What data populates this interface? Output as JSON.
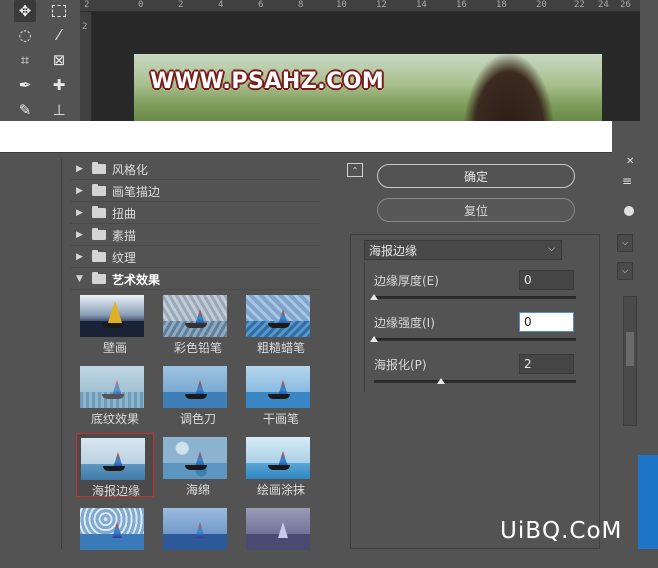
{
  "photoshop": {
    "ruler_top": [
      "2",
      "0",
      "2",
      "4",
      "6",
      "8",
      "10",
      "12",
      "14",
      "16",
      "18",
      "20",
      "22",
      "24",
      "26"
    ],
    "ruler_left": [
      "2"
    ],
    "photo_watermark": "WWW.PSAHZ.COM",
    "tools": [
      "move-icon",
      "marquee-icon",
      "lasso-icon",
      "magic-wand-icon",
      "crop-icon",
      "frame-icon",
      "eyedropper-icon",
      "healing-icon",
      "brush-icon",
      "stamp-icon"
    ]
  },
  "filter_gallery": {
    "categories": [
      {
        "label": "风格化",
        "open": false
      },
      {
        "label": "画笔描边",
        "open": false
      },
      {
        "label": "扭曲",
        "open": false
      },
      {
        "label": "素描",
        "open": false
      },
      {
        "label": "纹理",
        "open": false
      },
      {
        "label": "艺术效果",
        "open": true
      }
    ],
    "thumbnails": [
      {
        "label": "壁画",
        "selected": false
      },
      {
        "label": "彩色铅笔",
        "selected": false
      },
      {
        "label": "粗糙蜡笔",
        "selected": false
      },
      {
        "label": "底纹效果",
        "selected": false
      },
      {
        "label": "调色刀",
        "selected": false
      },
      {
        "label": "干画笔",
        "selected": false
      },
      {
        "label": "海报边缘",
        "selected": true
      },
      {
        "label": "海绵",
        "selected": false
      },
      {
        "label": "绘画涂抹",
        "selected": false
      },
      {
        "label": "",
        "selected": false
      },
      {
        "label": "",
        "selected": false
      },
      {
        "label": "",
        "selected": false
      }
    ],
    "ok_label": "确定",
    "reset_label": "复位",
    "selected_filter": "海报边缘",
    "params": [
      {
        "label": "边缘厚度(E)",
        "value": "0",
        "slider": 0.0
      },
      {
        "label": "边缘强度(I)",
        "value": "0",
        "slider": 0.0
      },
      {
        "label": "海报化(P)",
        "value": "2",
        "slider": 0.33
      }
    ],
    "colors": {
      "selection_border": "#c83030",
      "focus_border": "#4b8fd8"
    }
  },
  "site_watermark": "UiBQ.CoM"
}
